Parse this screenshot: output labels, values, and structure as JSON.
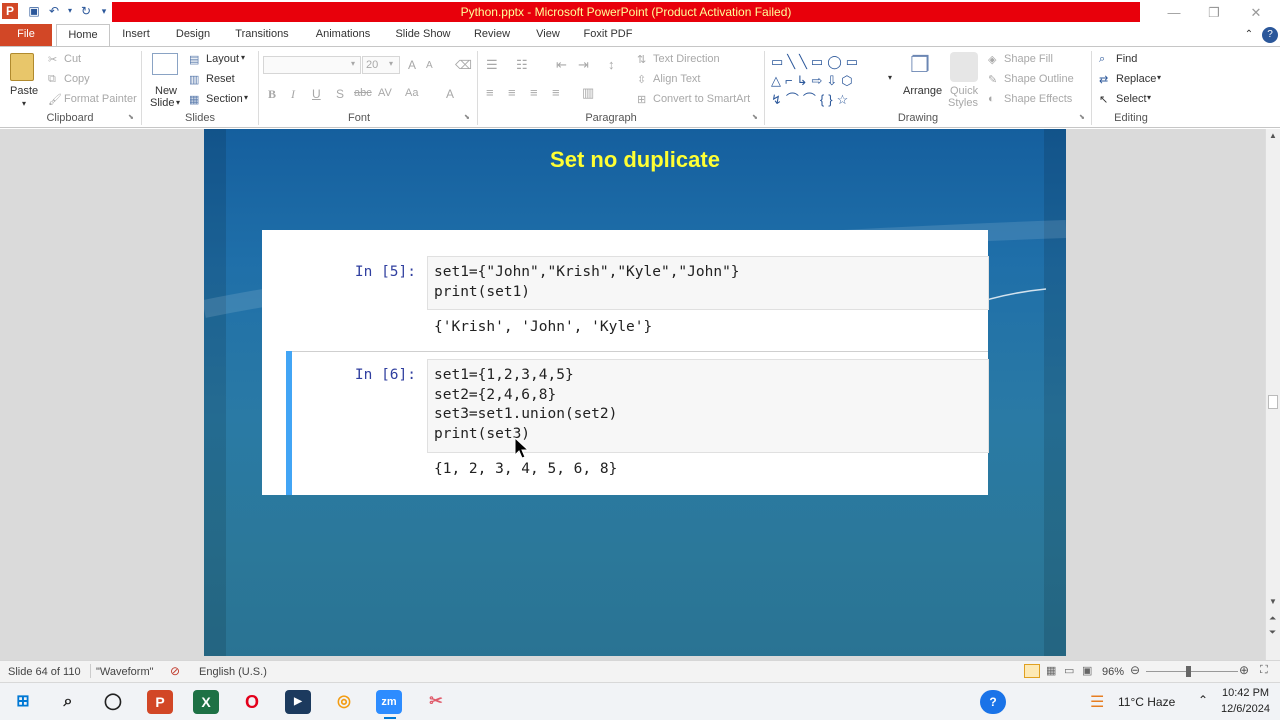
{
  "window": {
    "title": "Python.pptx - Microsoft PowerPoint (Product Activation Failed)"
  },
  "tabs": [
    "File",
    "Home",
    "Insert",
    "Design",
    "Transitions",
    "Animations",
    "Slide Show",
    "Review",
    "View",
    "Foxit PDF"
  ],
  "ribbon": {
    "clipboard": {
      "paste": "Paste",
      "cut": "Cut",
      "copy": "Copy",
      "format_painter": "Format Painter",
      "label": "Clipboard"
    },
    "slides": {
      "new_slide_1": "New",
      "new_slide_2": "Slide",
      "layout": "Layout",
      "reset": "Reset",
      "section": "Section",
      "label": "Slides"
    },
    "font": {
      "size": "20",
      "label": "Font"
    },
    "paragraph": {
      "text_direction": "Text Direction",
      "align_text": "Align Text",
      "convert_smartart": "Convert to SmartArt",
      "label": "Paragraph"
    },
    "drawing": {
      "arrange": "Arrange",
      "quick_styles_1": "Quick",
      "quick_styles_2": "Styles",
      "shape_fill": "Shape Fill",
      "shape_outline": "Shape Outline",
      "shape_effects": "Shape Effects",
      "label": "Drawing"
    },
    "editing": {
      "find": "Find",
      "replace": "Replace",
      "select": "Select",
      "label": "Editing"
    }
  },
  "slide": {
    "title": "Set no duplicate",
    "cells": [
      {
        "prompt": "In [5]:",
        "code_lines": [
          "set1={\"John\",\"Krish\",\"Kyle\",\"John\"}",
          "print(set1)"
        ],
        "output": "{'Krish', 'John', 'Kyle'}"
      },
      {
        "prompt": "In [6]:",
        "code_lines": [
          "set1={1,2,3,4,5}",
          "set2={2,4,6,8}",
          "set3=set1.union(set2)",
          "print(set3)"
        ],
        "output": "{1, 2, 3, 4, 5, 6, 8}"
      }
    ]
  },
  "status": {
    "slide": "Slide 64 of 110",
    "theme": "\"Waveform\"",
    "language": "English (U.S.)",
    "zoom": "96%"
  },
  "taskbar": {
    "weather": "11°C  Haze",
    "time": "10:42 PM",
    "date": "12/6/2024"
  }
}
